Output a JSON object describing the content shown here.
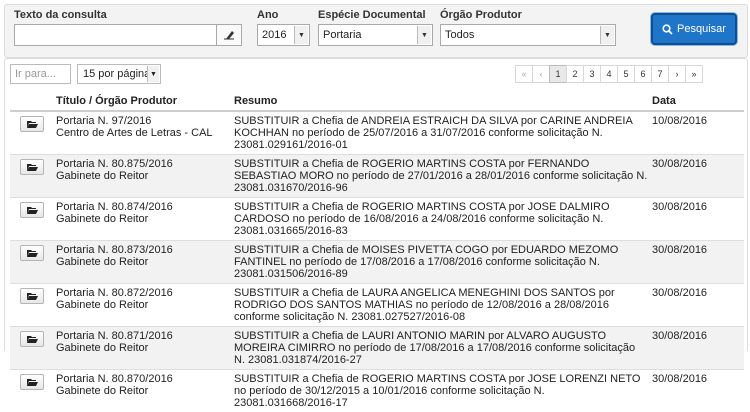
{
  "search": {
    "text_label": "Texto da consulta",
    "text_value": "",
    "year_label": "Ano",
    "year_value": "2016",
    "species_label": "Espécie Documental",
    "species_value": "Portaria",
    "organ_label": "Órgão Produtor",
    "organ_value": "Todos",
    "search_button": "Pesquisar"
  },
  "list": {
    "filter_placeholder": "Ir para...",
    "per_page": "15 por página",
    "pagination": [
      "«",
      "‹",
      "1",
      "2",
      "3",
      "4",
      "5",
      "6",
      "7",
      "›",
      "»"
    ],
    "active_page": "1"
  },
  "table": {
    "headers": {
      "title": "Título / Órgão Produtor",
      "summary": "Resumo",
      "date": "Data"
    },
    "rows": [
      {
        "title": "Portaria N. 97/2016",
        "organ": "Centro de Artes de Letras - CAL",
        "summary": "SUBSTITUIR a Chefia de ANDREIA ESTRAICH DA SILVA por CARINE ANDREIA KOCHHAN no período de 25/07/2016 a 31/07/2016 conforme solicitação N. 23081.029161/2016-01",
        "date": "10/08/2016"
      },
      {
        "title": "Portaria N. 80.875/2016",
        "organ": "Gabinete do Reitor",
        "summary": "SUBSTITUIR a Chefia de ROGERIO MARTINS COSTA por FERNANDO SEBASTIAO MORO no período de 27/01/2016 a 28/01/2016 conforme solicitação N. 23081.031670/2016-96",
        "date": "30/08/2016"
      },
      {
        "title": "Portaria N. 80.874/2016",
        "organ": "Gabinete do Reitor",
        "summary": "SUBSTITUIR a Chefia de ROGERIO MARTINS COSTA por JOSE DALMIRO CARDOSO no período de 16/08/2016 a 24/08/2016 conforme solicitação N. 23081.031665/2016-83",
        "date": "30/08/2016"
      },
      {
        "title": "Portaria N. 80.873/2016",
        "organ": "Gabinete do Reitor",
        "summary": "SUBSTITUIR a Chefia de MOISES PIVETTA COGO por EDUARDO MEZOMO FANTINEL no período de 17/08/2016 a 17/08/2016 conforme solicitação N. 23081.031506/2016-89",
        "date": "30/08/2016"
      },
      {
        "title": "Portaria N. 80.872/2016",
        "organ": "Gabinete do Reitor",
        "summary": "SUBSTITUIR a Chefia de LAURA ANGELICA MENEGHINI DOS SANTOS por RODRIGO DOS SANTOS MATHIAS no período de 12/08/2016 a 28/08/2016 conforme solicitação N. 23081.027527/2016-08",
        "date": "30/08/2016"
      },
      {
        "title": "Portaria N. 80.871/2016",
        "organ": "Gabinete do Reitor",
        "summary": "SUBSTITUIR a Chefia de LAURI ANTONIO MARIN por ALVARO AUGUSTO MOREIRA CIMIRRO no período de 17/08/2016 a 17/08/2016 conforme solicitação N. 23081.031874/2016-27",
        "date": "30/08/2016"
      },
      {
        "title": "Portaria N. 80.870/2016",
        "organ": "Gabinete do Reitor",
        "summary": "SUBSTITUIR a Chefia de ROGERIO MARTINS COSTA por JOSE LORENZI NETO no período de 30/12/2015 a 10/01/2016 conforme solicitação N. 23081.031668/2016-17",
        "date": "30/08/2016"
      }
    ]
  },
  "colors": {
    "primary_button": "#1f76c9",
    "row_alt": "#f2f2f2"
  },
  "icons": {
    "clear": "eraser-icon",
    "search": "search-icon",
    "open": "folder-open-icon"
  }
}
